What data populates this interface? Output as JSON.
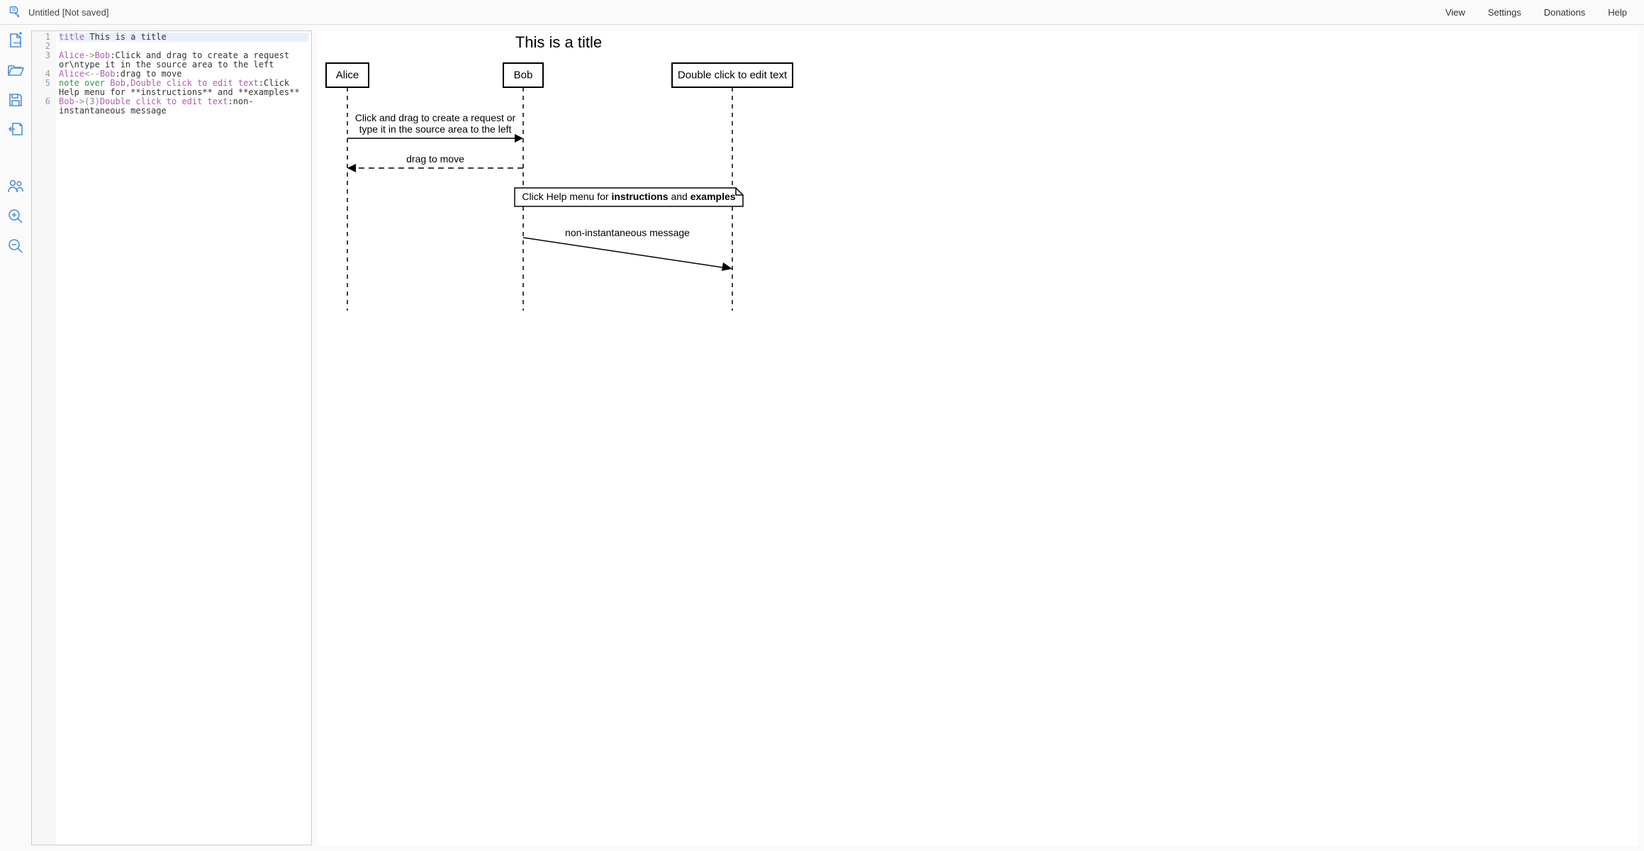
{
  "header": {
    "doc_title": "Untitled [Not saved]",
    "menu": {
      "view": "View",
      "settings": "Settings",
      "donations": "Donations",
      "help": "Help"
    }
  },
  "editor": {
    "line_numbers": [
      "1",
      "2",
      "3",
      "4",
      "5",
      "6"
    ],
    "lines": [
      {
        "segments": [
          {
            "cls": "kw-title",
            "t": "title"
          },
          {
            "cls": "kw-text",
            "t": " This is a title"
          }
        ],
        "highlighted": true
      },
      {
        "segments": []
      },
      {
        "segments": [
          {
            "cls": "kw-actor",
            "t": "Alice"
          },
          {
            "cls": "kw-arrow",
            "t": "->"
          },
          {
            "cls": "kw-actor",
            "t": "Bob"
          },
          {
            "cls": "kw-text",
            "t": ":Click and drag to create a request or\\ntype it in the source area to the left"
          }
        ]
      },
      {
        "segments": [
          {
            "cls": "kw-actor",
            "t": "Alice"
          },
          {
            "cls": "kw-arrow",
            "t": "<--"
          },
          {
            "cls": "kw-actor",
            "t": "Bob"
          },
          {
            "cls": "kw-text",
            "t": ":drag to move"
          }
        ]
      },
      {
        "segments": [
          {
            "cls": "kw-note",
            "t": "note over "
          },
          {
            "cls": "kw-actor",
            "t": "Bob,Double click to edit text"
          },
          {
            "cls": "kw-text",
            "t": ":Click Help menu for **instructions** and **examples**"
          }
        ]
      },
      {
        "segments": [
          {
            "cls": "kw-actor",
            "t": "Bob"
          },
          {
            "cls": "kw-arrow",
            "t": "->"
          },
          {
            "cls": "kw-num",
            "t": "(3)"
          },
          {
            "cls": "kw-actor",
            "t": "Double click to edit text"
          },
          {
            "cls": "kw-text",
            "t": ":non-instantaneous message"
          }
        ]
      }
    ]
  },
  "diagram": {
    "title": "This is a title",
    "participants": [
      {
        "id": "alice",
        "label": "Alice"
      },
      {
        "id": "bob",
        "label": "Bob"
      },
      {
        "id": "dct",
        "label": "Double click to edit text"
      }
    ],
    "msg1_l1": "Click and drag to create a request or",
    "msg1_l2": "type it in the source area to the left",
    "msg2": "drag to move",
    "note_prefix": "Click Help menu for ",
    "note_b1": "instructions",
    "note_mid": " and ",
    "note_b2": "examples",
    "msg3": "non-instantaneous message"
  }
}
